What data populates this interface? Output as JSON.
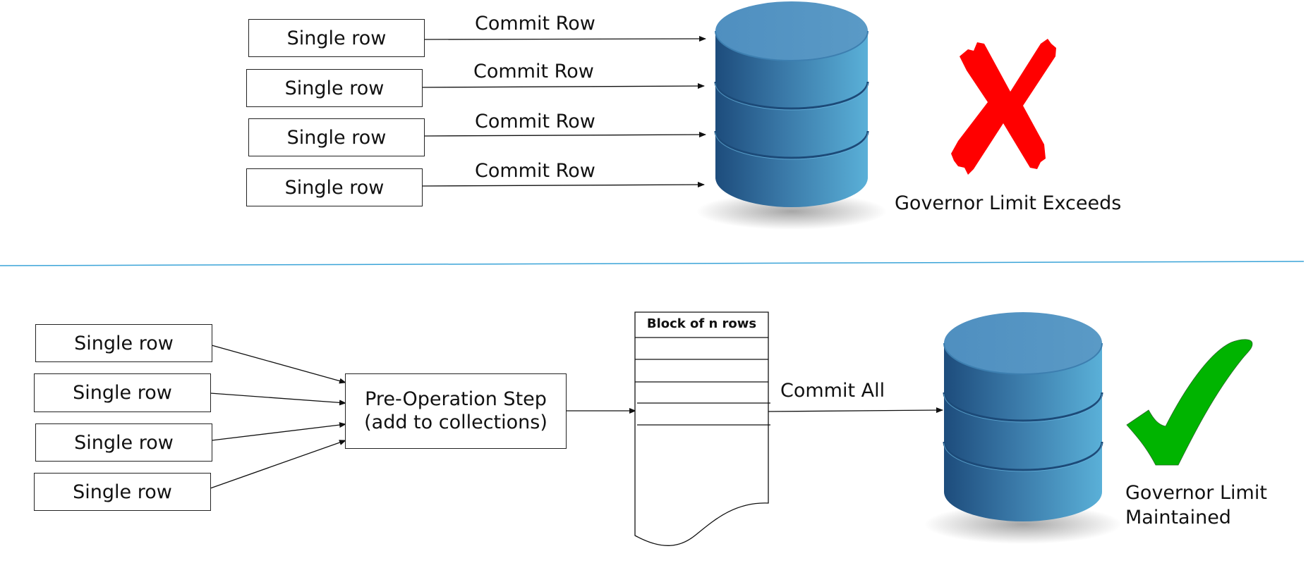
{
  "top_section": {
    "rows": [
      {
        "label": "Single row",
        "arrow_label": "Commit Row"
      },
      {
        "label": "Single row",
        "arrow_label": "Commit Row"
      },
      {
        "label": "Single row",
        "arrow_label": "Commit Row"
      },
      {
        "label": "Single row",
        "arrow_label": "Commit Row"
      }
    ],
    "database_icon": "database-icon",
    "status_icon": "red-x-icon",
    "status_text": "Governor Limit Exceeds"
  },
  "bottom_section": {
    "rows": [
      {
        "label": "Single row"
      },
      {
        "label": "Single row"
      },
      {
        "label": "Single row"
      },
      {
        "label": "Single row"
      }
    ],
    "pre_operation": {
      "line1": "Pre-Operation Step",
      "line2": "(add to collections)"
    },
    "block": {
      "header": "Block of n rows"
    },
    "commit_label": "Commit All",
    "database_icon": "database-icon",
    "status_icon": "green-check-icon",
    "status_text_line1": "Governor Limit",
    "status_text_line2": "Maintained"
  },
  "colors": {
    "divider": "#3ba4d8",
    "db_dark": "#1d4c7c",
    "db_light": "#5ab0d8",
    "db_top": "#5597c4",
    "error": "#ff0000",
    "success": "#00b400"
  }
}
